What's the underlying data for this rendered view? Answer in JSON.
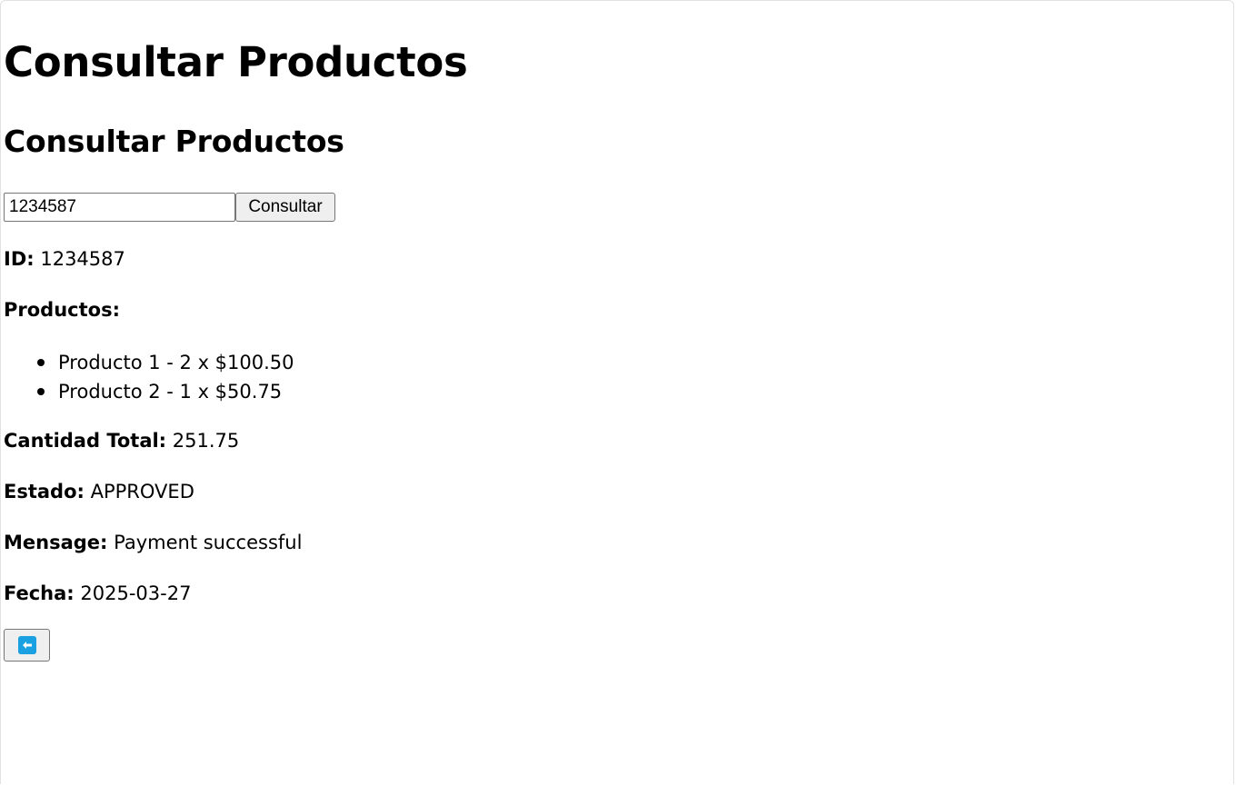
{
  "page": {
    "title": "Consultar Productos",
    "subtitle": "Consultar Productos"
  },
  "search": {
    "value": "1234587",
    "button_label": "Consultar"
  },
  "result": {
    "id_label": "ID:",
    "id_value": "1234587",
    "products_label": "Productos:",
    "products": [
      "Producto 1 - 2 x $100.50",
      "Producto 2 - 1 x $50.75"
    ],
    "total_label": "Cantidad Total:",
    "total_value": "251.75",
    "status_label": "Estado:",
    "status_value": "APPROVED",
    "message_label": "Mensage:",
    "message_value": "Payment successful",
    "date_label": "Fecha:",
    "date_value": "2025-03-27"
  },
  "back_button": {
    "icon": "back-arrow-icon",
    "icon_color": "#1ba1e2"
  }
}
